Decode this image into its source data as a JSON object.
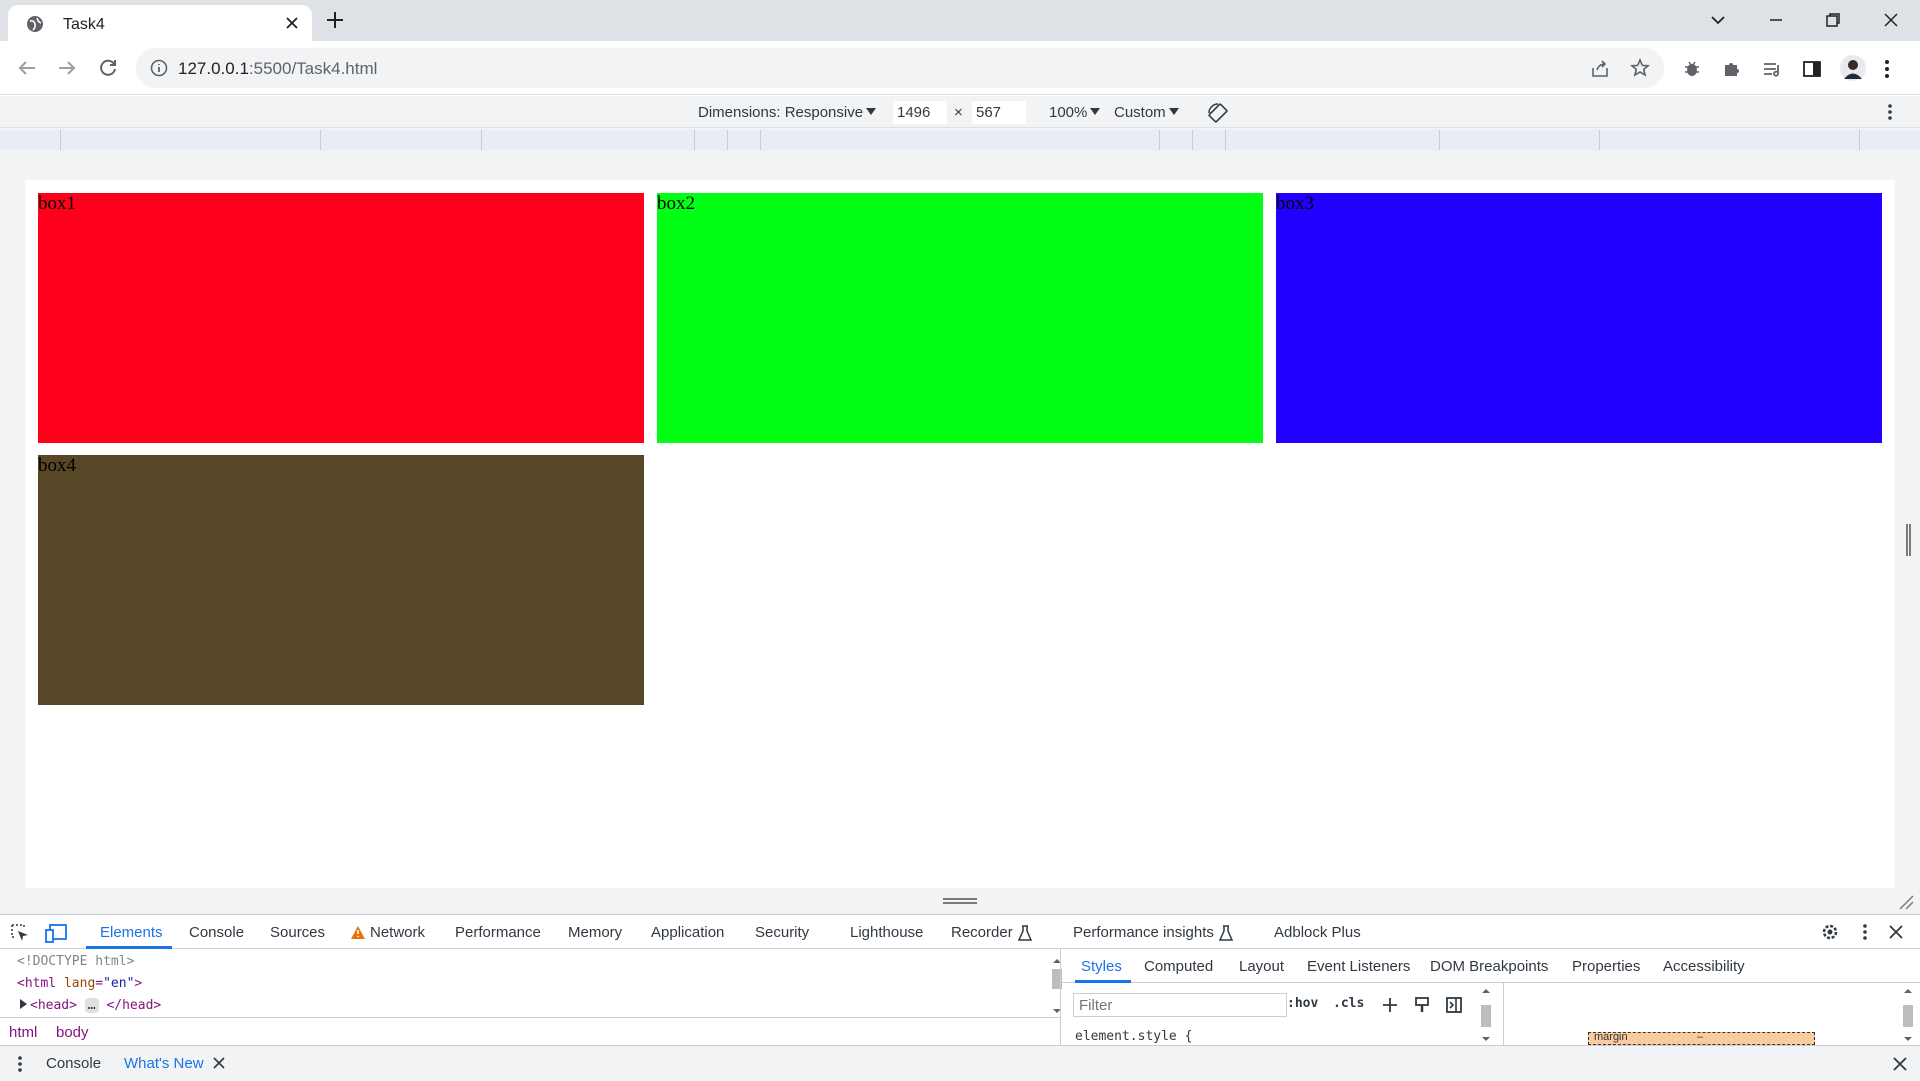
{
  "browser": {
    "tab_title": "Task4",
    "url_host": "127.0.0.1",
    "url_rest": ":5500/Task4.html"
  },
  "device_toolbar": {
    "dimensions_label": "Dimensions: Responsive",
    "width": "1496",
    "times": "×",
    "height": "567",
    "zoom": "100%",
    "throttle": "Custom"
  },
  "page": {
    "boxes": [
      {
        "label": "box1",
        "color": "#ff001c"
      },
      {
        "label": "box2",
        "color": "#00ff15"
      },
      {
        "label": "box3",
        "color": "#2200ff"
      },
      {
        "label": "box4",
        "color": "#584726"
      }
    ]
  },
  "devtools": {
    "tabs": [
      "Elements",
      "Console",
      "Sources",
      "Network",
      "Performance",
      "Memory",
      "Application",
      "Security",
      "Lighthouse",
      "Recorder",
      "Performance insights",
      "Adblock Plus"
    ],
    "active_tab": "Elements",
    "dom": {
      "doctype": "<!DOCTYPE html>",
      "html_tag": "<html ",
      "html_attr": "lang",
      "html_eq": "=",
      "html_val": "\"en\"",
      "html_close": ">",
      "head_open": "<head>",
      "head_ellipsis": "…",
      "head_close": "</head>"
    },
    "breadcrumbs": [
      "html",
      "body"
    ],
    "styles_tabs": [
      "Styles",
      "Computed",
      "Layout",
      "Event Listeners",
      "DOM Breakpoints",
      "Properties",
      "Accessibility"
    ],
    "filter_placeholder": "Filter",
    "hov": ":hov",
    "cls": ".cls",
    "element_style": "element.style {",
    "box_model_label": "margin",
    "box_model_dash": "–",
    "drawer_tabs": [
      "Console",
      "What's New"
    ]
  }
}
